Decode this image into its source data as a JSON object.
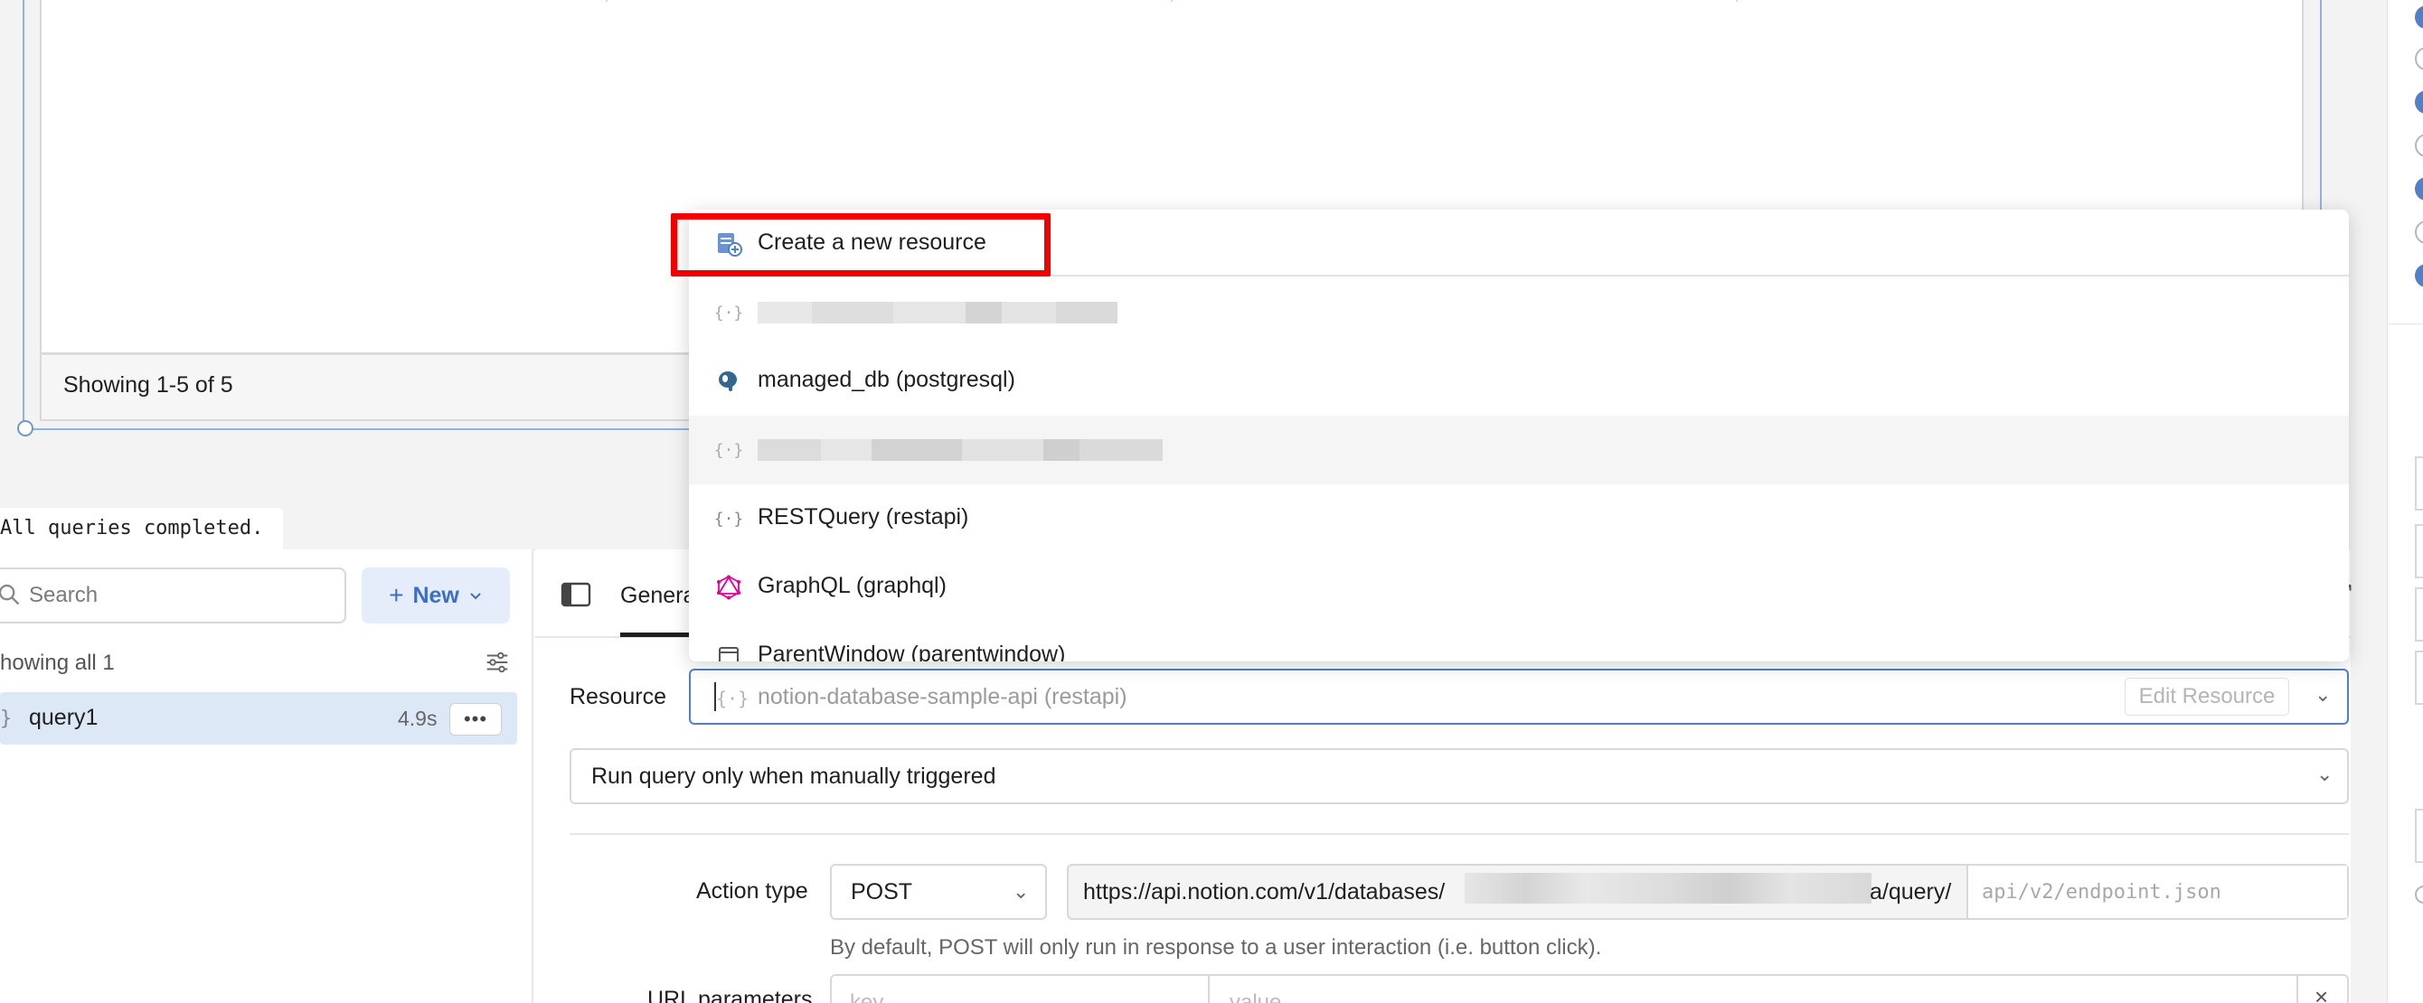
{
  "table": {
    "footer_text": "Showing 1-5 of 5"
  },
  "status": {
    "message": "All queries completed."
  },
  "query_list": {
    "search_placeholder": "Search",
    "new_button_label": "New",
    "showing_all_label": "howing all 1",
    "queries": [
      {
        "name": "query1",
        "duration": "4.9s",
        "more_label": "•••"
      }
    ]
  },
  "editor": {
    "tab_general_label": "Genera",
    "resource_label": "Resource",
    "resource_placeholder": "notion-database-sample-api (restapi)",
    "edit_resource_label": "Edit Resource",
    "trigger_value": "Run query only when manually triggered",
    "action_type_label": "Action type",
    "action_type_value": "POST",
    "url_prefix": "https://api.notion.com/v1/databases/",
    "url_suffix": "a/query/",
    "endpoint_placeholder": "api/v2/endpoint.json",
    "post_hint": "By default, POST will only run in response to a user interaction (i.e. button click).",
    "url_params_label": "URL parameters",
    "params_key_placeholder": "key",
    "params_value_placeholder": "value"
  },
  "dropdown": {
    "items": [
      {
        "label": "Create a new resource",
        "icon": "create-resource-icon"
      },
      {
        "label": "",
        "icon": "restapi-icon",
        "redacted": true
      },
      {
        "label": "managed_db (postgresql)",
        "icon": "postgresql-icon"
      },
      {
        "label": "",
        "icon": "restapi-icon",
        "redacted": true
      },
      {
        "label": "RESTQuery (restapi)",
        "icon": "restapi-icon"
      },
      {
        "label": "GraphQL (graphql)",
        "icon": "graphql-icon"
      },
      {
        "label": "ParentWindow (parentwindow)",
        "icon": "parentwindow-icon"
      }
    ]
  },
  "colors": {
    "accent_blue": "#4f80c8",
    "highlight_red": "#f20000",
    "selected_row": "#dde8f7",
    "graphql_pink": "#e10098"
  }
}
